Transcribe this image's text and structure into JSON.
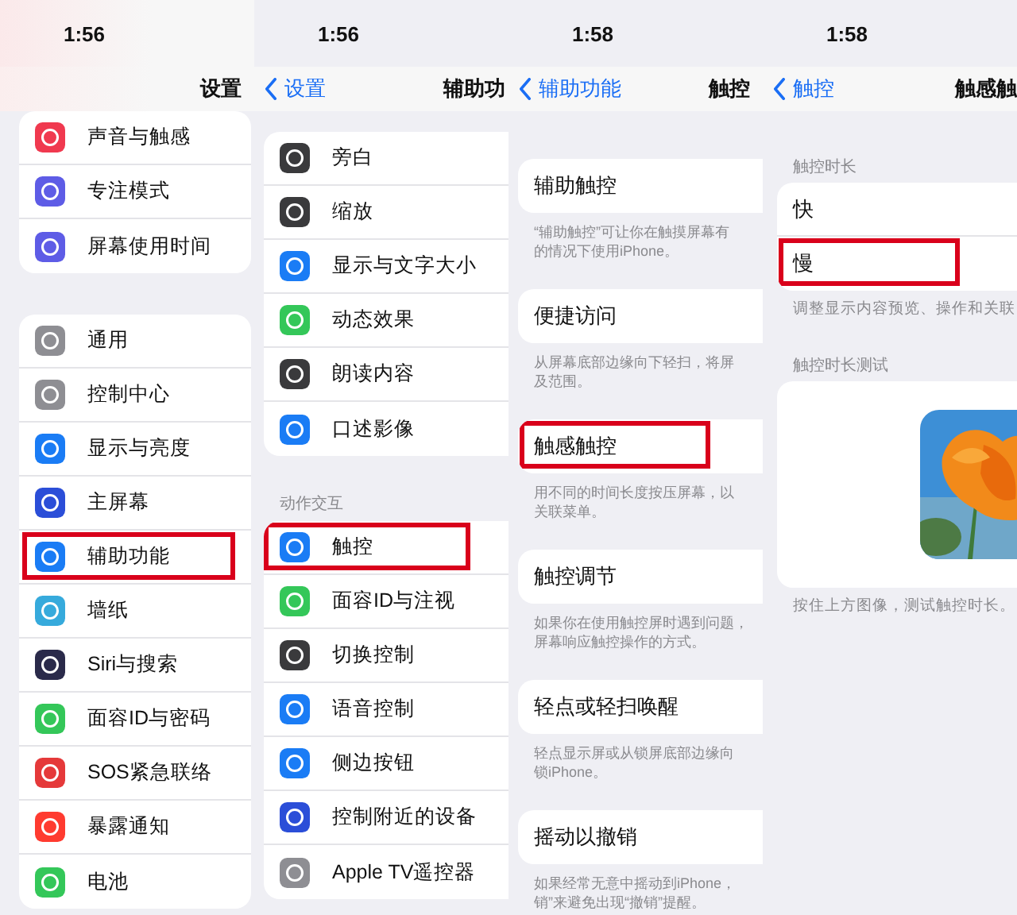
{
  "panels": [
    {
      "time": "1:56",
      "nav": {
        "title": "设置"
      },
      "groups": [
        {
          "kind": "rows",
          "rows": [
            {
              "label": "声音与触感",
              "color": "#f0394f",
              "highlighted": false
            },
            {
              "label": "专注模式",
              "color": "#5e5ce6",
              "highlighted": false
            },
            {
              "label": "屏幕使用时间",
              "color": "#5e5ce6",
              "highlighted": false
            }
          ]
        },
        {
          "kind": "rows",
          "rows": [
            {
              "label": "通用",
              "color": "#8e8e93",
              "highlighted": false
            },
            {
              "label": "控制中心",
              "color": "#8e8e93",
              "highlighted": false
            },
            {
              "label": "显示与亮度",
              "color": "#1a7cf5",
              "highlighted": false
            },
            {
              "label": "主屏幕",
              "color": "#2b4ed8",
              "highlighted": false
            },
            {
              "label": "辅助功能",
              "color": "#1a7cf5",
              "highlighted": true
            },
            {
              "label": "墙纸",
              "color": "#36aadc",
              "highlighted": false
            },
            {
              "label": "Siri与搜索",
              "color": "#2a2a4a",
              "highlighted": false
            },
            {
              "label": "面容ID与密码",
              "color": "#34c759",
              "highlighted": false
            },
            {
              "label": "SOS紧急联络",
              "color": "#e5393a",
              "highlighted": false
            },
            {
              "label": "暴露通知",
              "color": "#ff3b30",
              "highlighted": false
            },
            {
              "label": "电池",
              "color": "#34c759",
              "highlighted": false
            }
          ]
        }
      ]
    },
    {
      "time": "1:56",
      "nav": {
        "back": "设置",
        "title": "辅助功"
      },
      "groups": [
        {
          "kind": "rows",
          "rows": [
            {
              "label": "旁白",
              "color": "#3a3a3c",
              "highlighted": false
            },
            {
              "label": "缩放",
              "color": "#3a3a3c",
              "highlighted": false
            },
            {
              "label": "显示与文字大小",
              "color": "#1a7cf5",
              "highlighted": false
            },
            {
              "label": "动态效果",
              "color": "#34c759",
              "highlighted": false
            },
            {
              "label": "朗读内容",
              "color": "#3a3a3c",
              "highlighted": false
            },
            {
              "label": "口述影像",
              "color": "#1a7cf5",
              "highlighted": false
            }
          ]
        },
        {
          "kind": "rows",
          "header": "动作交互",
          "rows": [
            {
              "label": "触控",
              "color": "#1a7cf5",
              "highlighted": true
            },
            {
              "label": "面容ID与注视",
              "color": "#34c759",
              "highlighted": false
            },
            {
              "label": "切换控制",
              "color": "#3a3a3c",
              "highlighted": false
            },
            {
              "label": "语音控制",
              "color": "#1a7cf5",
              "highlighted": false
            },
            {
              "label": "侧边按钮",
              "color": "#1a7cf5",
              "highlighted": false
            },
            {
              "label": "控制附近的设备",
              "color": "#2b4ed8",
              "highlighted": false
            },
            {
              "label": "Apple TV遥控器",
              "color": "#8e8e93",
              "highlighted": false
            }
          ]
        }
      ]
    },
    {
      "time": "1:58",
      "nav": {
        "back": "辅助功能",
        "title": "触控"
      },
      "groups": [
        {
          "kind": "rows",
          "rows": [
            {
              "label": "辅助触控",
              "highlighted": false
            }
          ],
          "footer": [
            "“辅助触控”可让你在触摸屏幕有",
            "的情况下使用iPhone。"
          ]
        },
        {
          "kind": "rows",
          "rows": [
            {
              "label": "便捷访问",
              "highlighted": false
            }
          ],
          "footer": [
            "从屏幕底部边缘向下轻扫，将屏",
            "及范围。"
          ]
        },
        {
          "kind": "rows",
          "rows": [
            {
              "label": "触感触控",
              "highlighted": true
            }
          ],
          "footer": [
            "用不同的时间长度按压屏幕，以",
            "关联菜单。"
          ]
        },
        {
          "kind": "rows",
          "rows": [
            {
              "label": "触控调节",
              "highlighted": false
            }
          ],
          "footer": [
            "如果你在使用触控屏时遇到问题，",
            "屏幕响应触控操作的方式。"
          ]
        },
        {
          "kind": "rows",
          "rows": [
            {
              "label": "轻点或轻扫唤醒",
              "highlighted": false
            }
          ],
          "footer": [
            "轻点显示屏或从锁屏底部边缘向",
            "锁iPhone。"
          ]
        },
        {
          "kind": "rows",
          "rows": [
            {
              "label": "摇动以撤销",
              "highlighted": false
            }
          ],
          "footer": [
            "如果经常无意中摇动到iPhone，",
            "销”来避免出现“撤销”提醒。"
          ]
        }
      ]
    },
    {
      "time": "1:58",
      "nav": {
        "back": "触控",
        "title": "触感触"
      },
      "groups": [
        {
          "kind": "rows",
          "header": "触控时长",
          "rows": [
            {
              "label": "快",
              "highlighted": false
            },
            {
              "label": "慢",
              "highlighted": true
            }
          ],
          "footer": [
            "调整显示内容预览、操作和关联"
          ]
        },
        {
          "kind": "picture",
          "header": "触控时长测试",
          "footer": [
            "按住上方图像，测试触控时长。"
          ]
        }
      ]
    }
  ]
}
